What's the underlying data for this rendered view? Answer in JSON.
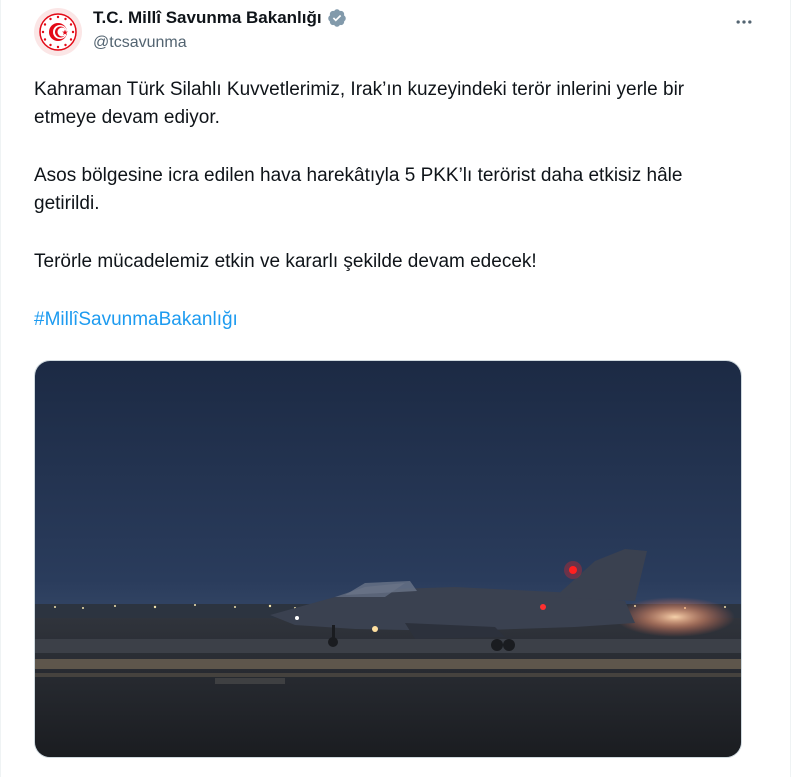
{
  "author": {
    "display_name": "T.C. Millî Savunma Bakanlığı",
    "handle": "@tcsavunma",
    "verified_icon": "verified-badge-icon",
    "avatar_icon": "turkish-ministry-emblem-icon"
  },
  "tweet": {
    "paragraphs": [
      "Kahraman Türk Silahlı Kuvvetlerimiz, Irak’ın kuzeyindeki terör inlerini yerle bir etmeye devam ediyor.",
      "Asos bölgesine icra edilen hava harekâtıyla 5 PKK’lı terörist daha etkisiz hâle getirildi.",
      "Terörle mücadelemiz etkin ve kararlı şekilde devam edecek!"
    ],
    "hashtag": "#MillîSavunmaBakanlığı"
  },
  "media": {
    "type": "video-still",
    "subject": "fighter jet on runway at dusk"
  },
  "colors": {
    "accent": "#1d9bf0",
    "text": "#0f1419",
    "secondary_text": "#536471",
    "emblem_red": "#e30a17"
  }
}
